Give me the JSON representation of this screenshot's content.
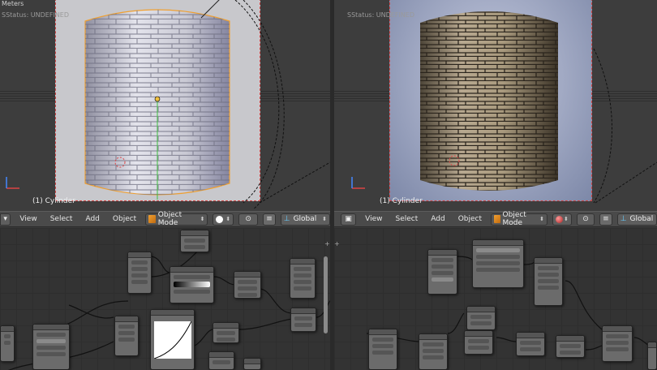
{
  "left_viewport": {
    "units": "Meters",
    "status": "SStatus: UNDEFINED",
    "object_label": "(1) Cylinder"
  },
  "right_viewport": {
    "status": "SStatus: UNDEFINED",
    "object_label": "(1) Cylinder"
  },
  "left_header": {
    "menus": [
      "View",
      "Select",
      "Add",
      "Object"
    ],
    "mode": "Object Mode",
    "orientation": "Global"
  },
  "right_header": {
    "menus": [
      "View",
      "Select",
      "Add",
      "Object"
    ],
    "mode": "Object Mode",
    "orientation": "Global"
  },
  "colors": {
    "viewport_bg": "#3d3d3d",
    "camera_frame": "#cc4444",
    "selection_outline": "#f0a030",
    "node_body": "#6b6b6b"
  }
}
